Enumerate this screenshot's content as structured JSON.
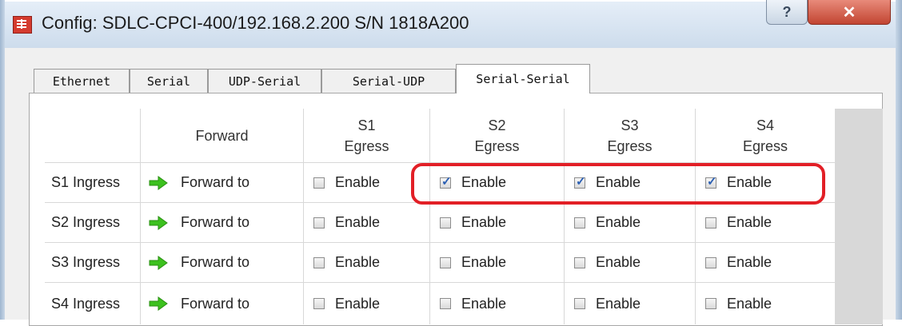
{
  "window": {
    "title": "Config: SDLC-CPCI-400/192.168.2.200 S/N 1818A200",
    "help_label": "?",
    "close_label": "✕"
  },
  "tabs": [
    {
      "label": "Ethernet",
      "active": false
    },
    {
      "label": "Serial",
      "active": false
    },
    {
      "label": "UDP-Serial",
      "active": false
    },
    {
      "label": "Serial-UDP",
      "active": false
    },
    {
      "label": "Serial-Serial",
      "active": true
    }
  ],
  "table": {
    "headers": {
      "forward": "Forward",
      "egress": [
        {
          "top": "S1",
          "bottom": "Egress"
        },
        {
          "top": "S2",
          "bottom": "Egress"
        },
        {
          "top": "S3",
          "bottom": "Egress"
        },
        {
          "top": "S4",
          "bottom": "Egress"
        }
      ]
    },
    "rows": [
      {
        "label": "S1 Ingress",
        "forward": "Forward to",
        "checks": [
          {
            "label": "Enable",
            "checked": false
          },
          {
            "label": "Enable",
            "checked": true
          },
          {
            "label": "Enable",
            "checked": true
          },
          {
            "label": "Enable",
            "checked": true
          }
        ]
      },
      {
        "label": "S2 Ingress",
        "forward": "Forward to",
        "checks": [
          {
            "label": "Enable",
            "checked": false
          },
          {
            "label": "Enable",
            "checked": false
          },
          {
            "label": "Enable",
            "checked": false
          },
          {
            "label": "Enable",
            "checked": false
          }
        ]
      },
      {
        "label": "S3 Ingress",
        "forward": "Forward to",
        "checks": [
          {
            "label": "Enable",
            "checked": false
          },
          {
            "label": "Enable",
            "checked": false
          },
          {
            "label": "Enable",
            "checked": false
          },
          {
            "label": "Enable",
            "checked": false
          }
        ]
      },
      {
        "label": "S4 Ingress",
        "forward": "Forward to",
        "checks": [
          {
            "label": "Enable",
            "checked": false
          },
          {
            "label": "Enable",
            "checked": false
          },
          {
            "label": "Enable",
            "checked": false
          },
          {
            "label": "Enable",
            "checked": false
          }
        ]
      }
    ]
  },
  "colors": {
    "highlight": "#e21f26",
    "arrow": "#3cc11e",
    "check": "#2b5fb3"
  },
  "icons": {
    "app": "app-logo-icon",
    "forward": "green-arrow-right-icon",
    "check": "checkmark-icon"
  }
}
